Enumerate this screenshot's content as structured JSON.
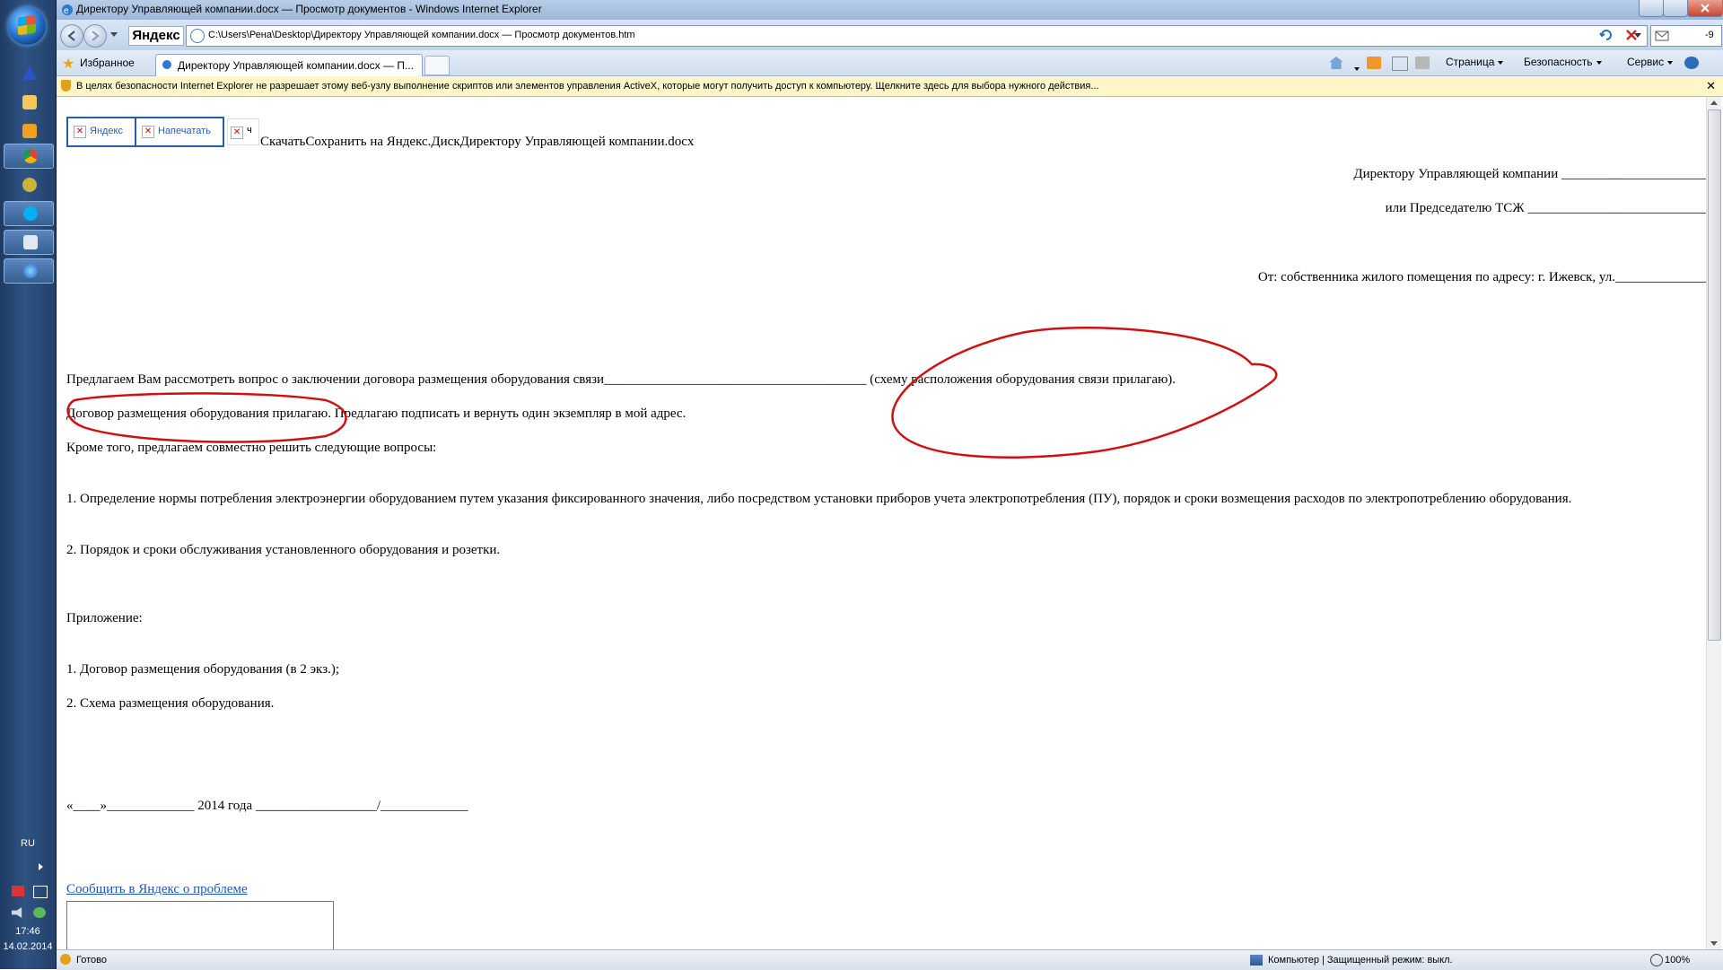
{
  "window": {
    "title": "Директору Управляющей компании.docx — Просмотр документов - Windows Internet Explorer"
  },
  "navbar": {
    "logo_text": "Яндекс",
    "address": "C:\\Users\\Рена\\Desktop\\Директору Управляющей компании.docx — Просмотр документов.htm",
    "search_hint": "-9"
  },
  "tabs": {
    "favorites_label": "Избранное",
    "active_tab_label": "Директору Управляющей компании.docx — П...",
    "commands": {
      "page": "Страница",
      "safety": "Безопасность",
      "tools": "Сервис"
    }
  },
  "infobar": {
    "text": "В целях безопасности Internet Explorer не разрешает этому веб-узлу выполнение скриптов или элементов управления ActiveX, которые могут получить доступ к компьютеру. Щелкните здесь для выбора нужного действия..."
  },
  "doc": {
    "button_yandex": "Яндекс",
    "button_print": "Напечатать",
    "button_extra": "ч",
    "toolbar_text": "СкачатьСохранить на Яндекс.ДискДиректору Управляющей компании.docx",
    "addressee_1": "Директору Управляющей компании ______________________",
    "addressee_2": "или Председателю ТСЖ ___________________________",
    "from_line": "От: собственника жилого помещения по адресу: г. Ижевск, ул.______________",
    "para_1": "Предлагаем Вам рассмотреть вопрос о заключении договора размещения оборудования связи_______________________________________ (схему расположения оборудования связи прилагаю).",
    "para_2": "Договор размещения оборудования прилагаю. Предлагаю подписать и вернуть один экземпляр в мой адрес.",
    "para_3": "Кроме того, предлагаем совместно решить следующие вопросы:",
    "item_1": "1. Определение нормы потребления электроэнергии оборудованием путем указания фиксированного значения, либо посредством установки приборов учета электропотребления (ПУ), порядок и сроки возмещения расходов по электропотреблению оборудования.",
    "item_2": "2. Порядок и сроки обслуживания установленного оборудования и розетки.",
    "appendix_title": "Приложение:",
    "appendix_1": "1. Договор размещения оборудования (в 2 экз.);",
    "appendix_2": "2. Схема размещения оборудования.",
    "signature_line": "«____»_____________ 2014 года __________________/_____________",
    "report_link": "Сообщить в Яндекс о проблеме"
  },
  "statusbar": {
    "status": "Готово",
    "zone": "Компьютер | Защищенный режим: выкл.",
    "zoom": "100%"
  },
  "taskbar": {
    "language": "RU",
    "time": "17:46",
    "date": "14.02.2014"
  },
  "colors": {
    "annotation_ink": "#d01010",
    "link": "#1f56b9",
    "button_border": "#2a5db0",
    "infobar_bg": "#fdf6c9"
  }
}
